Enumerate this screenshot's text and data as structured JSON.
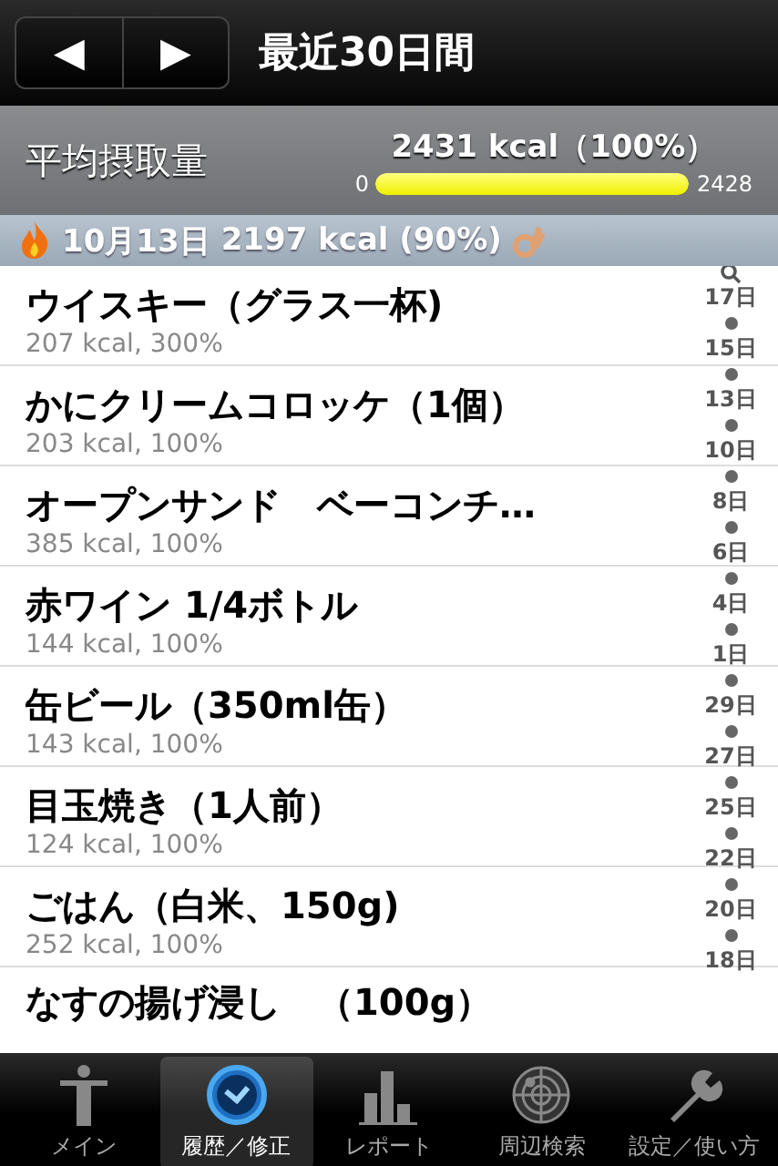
{
  "nav": {
    "title": "最近30日間",
    "prev": "◀",
    "next": "▶"
  },
  "summary": {
    "label": "平均摂取量",
    "value": "2431 kcal（100%）",
    "min": "0",
    "max": "2428",
    "level": 1
  },
  "section": {
    "date": "10月13日",
    "total": "2197 kcal (90%)"
  },
  "rows": [
    {
      "name": "ウイスキー（グラス一杯)",
      "detail": "207 kcal, 300%"
    },
    {
      "name": "かにクリームコロッケ（1個）",
      "detail": "203 kcal, 100%"
    },
    {
      "name": "オープンサンド　ベーコンチ…",
      "detail": "385 kcal, 100%"
    },
    {
      "name": "赤ワイン 1/4ボトル",
      "detail": "144 kcal, 100%"
    },
    {
      "name": "缶ビール（350ml缶）",
      "detail": "143 kcal, 100%"
    },
    {
      "name": "目玉焼き（1人前）",
      "detail": "124 kcal, 100%"
    },
    {
      "name": "ごはん（白米、150g)",
      "detail": "252 kcal, 100%"
    },
    {
      "name": "なすの揚げ浸し　（100g）"
    }
  ],
  "index": [
    "17日",
    "15日",
    "13日",
    "10日",
    "8日",
    "6日",
    "4日",
    "1日",
    "29日",
    "27日",
    "25日",
    "22日",
    "20日",
    "18日"
  ],
  "tabs": [
    {
      "label": "メイン",
      "selected": false
    },
    {
      "label": "履歴／修正",
      "selected": true
    },
    {
      "label": "レポート",
      "selected": false
    },
    {
      "label": "周辺検索",
      "selected": false
    },
    {
      "label": "設定／使い方",
      "selected": false
    }
  ]
}
